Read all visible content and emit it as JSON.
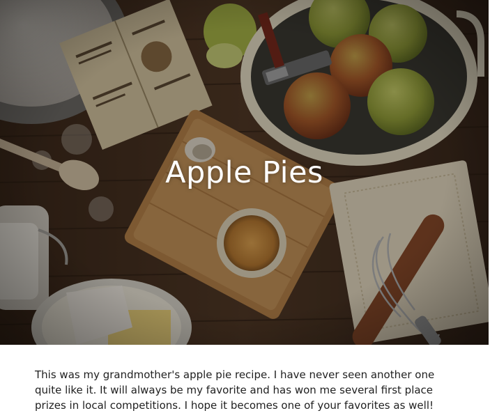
{
  "hero": {
    "title": "Apple Pies",
    "image_subject": "apples-baking-ingredients-photo"
  },
  "content": {
    "intro": "This was my grandmother's apple pie recipe. I have never seen another one quite like it. It will always be my favorite and has won me several first place prizes in local competitions. I hope it becomes one of your favorites as well!"
  },
  "colors": {
    "table_wood": "#4a3322",
    "cutting_board": "#b8844a",
    "apple_green": "#9aa63c",
    "apple_red": "#b5532a",
    "cream": "#efe3c8",
    "title_text": "#ffffff",
    "body_text": "#1f1f1f"
  }
}
